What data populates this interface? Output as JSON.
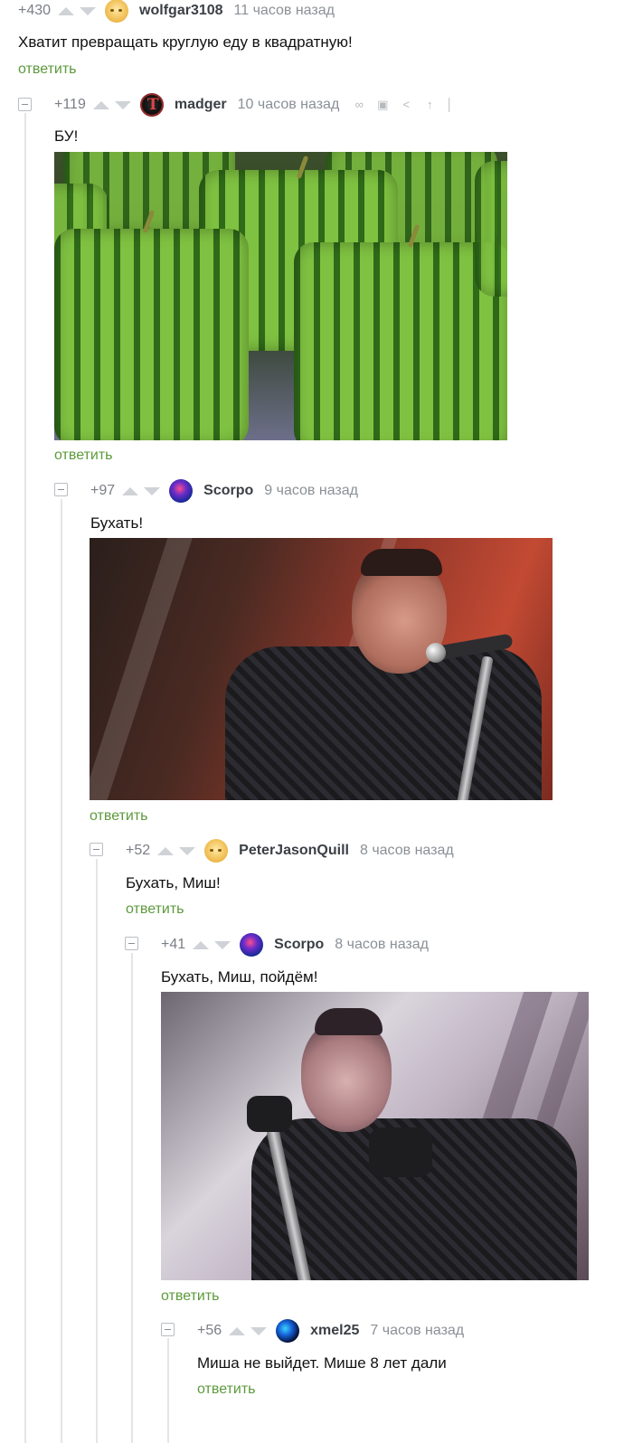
{
  "comments": [
    {
      "rating": "+430",
      "user": "wolfgar3108",
      "time": "11 часов назад",
      "text": "Хватит превращать круглую еду в квадратную!",
      "reply": "ответить",
      "avatar": "face-emoji-avatar"
    },
    {
      "rating": "+119",
      "user": "madger",
      "time": "10 часов назад",
      "text": "БУ!",
      "reply": "ответить",
      "avatar": "tool-logo-avatar",
      "image": "square-watermelons-photo"
    },
    {
      "rating": "+97",
      "user": "Scorpo",
      "time": "9 часов назад",
      "text": "Бухать!",
      "reply": "ответить",
      "avatar": "galaxy-avatar",
      "image": "singer-with-microphone-photo"
    },
    {
      "rating": "+52",
      "user": "PeterJasonQuill",
      "time": "8 часов назад",
      "text": "Бухать, Миш!",
      "reply": "ответить",
      "avatar": "face-emoji-avatar"
    },
    {
      "rating": "+41",
      "user": "Scorpo",
      "time": "8 часов назад",
      "text": "Бухать, Миш, пойдём!",
      "reply": "ответить",
      "avatar": "galaxy-avatar",
      "image": "singer-on-stage-photo"
    },
    {
      "rating": "+56",
      "user": "xmel25",
      "time": "7 часов назад",
      "text": "Миша не выйдет. Мише 8 лет дали",
      "reply": "ответить",
      "avatar": "blue-orb-avatar"
    }
  ],
  "toolbar_icons": [
    "link-icon",
    "save-icon",
    "share-icon",
    "scroll-up-icon",
    "more-icon"
  ],
  "colors": {
    "reply_link": "#5c9a3b",
    "meta": "#8b9096",
    "username": "#3b3f45",
    "thread_line": "#e3e5e8"
  }
}
